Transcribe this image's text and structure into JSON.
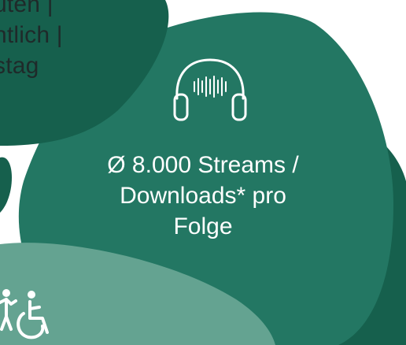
{
  "colors": {
    "dark_green": "#16604d",
    "mid_green": "#237763",
    "light_green": "#64a391",
    "text_dark": "#1f2a2a",
    "text_light": "#ffffff"
  },
  "info_bubble": {
    "lines": [
      "uten |",
      "ntlich |",
      "stag"
    ]
  },
  "stat_bubble": {
    "icon": "headphones-icon",
    "lines": [
      "Ø 8.000 Streams /",
      "Downloads* pro",
      "Folge"
    ]
  },
  "bottom_bubble": {
    "icon": "accessibility-icon"
  }
}
